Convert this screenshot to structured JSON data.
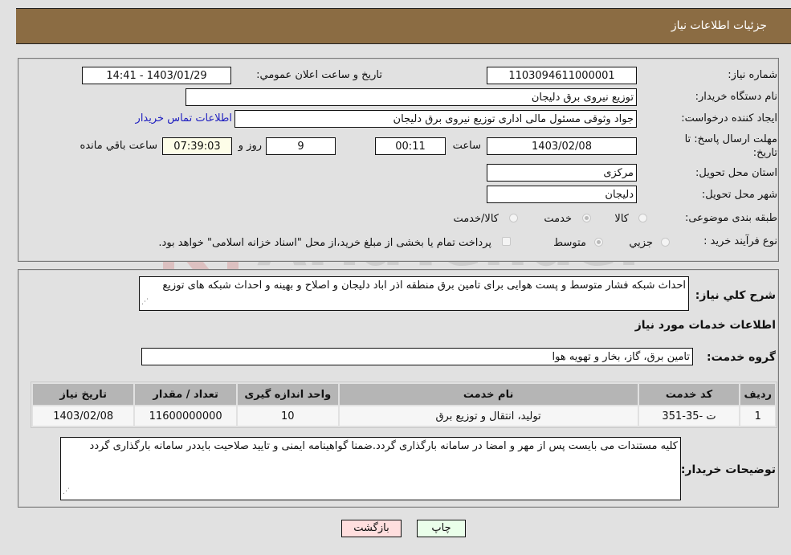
{
  "header": {
    "title": "جزئیات اطلاعات نیاز"
  },
  "details": {
    "need_number_label": "شماره نیاز:",
    "need_number": "1103094611000001",
    "announce_label": "تاریخ و ساعت اعلان عمومي:",
    "announce_value": "1403/01/29 - 14:41",
    "buyer_org_label": "نام دستگاه خریدار:",
    "buyer_org": "توزیع نیروی برق دلیجان",
    "creator_label": "ایجاد کننده درخواست:",
    "creator": "جواد وثوقی مسئول مالی اداری توزیع نیروی برق دلیجان",
    "buyer_contact_link": "اطلاعات تماس خریدار",
    "deadline_label": "مهلت ارسال پاسخ: تا تاریخ:",
    "deadline_date": "1403/02/08",
    "time_label": "ساعت",
    "deadline_time": "00:11",
    "days_value": "9",
    "days_label": "روز و",
    "remaining_time": "07:39:03",
    "remaining_label": "ساعت باقي مانده",
    "province_label": "استان محل تحویل:",
    "province": "مرکزی",
    "city_label": "شهر محل تحویل:",
    "city": "دلیجان",
    "category_label": "طبقه بندی موضوعی:",
    "category_options": [
      {
        "label": "کالا",
        "checked": false
      },
      {
        "label": "خدمت",
        "checked": true
      },
      {
        "label": "کالا/خدمت",
        "checked": false
      }
    ],
    "process_label": "نوع فرآیند خرید :",
    "process_options": [
      {
        "label": "جزیي",
        "checked": false
      },
      {
        "label": "متوسط",
        "checked": true
      }
    ],
    "treasury_note": "پرداخت تمام یا بخشی از مبلغ خرید،از محل \"اسناد خزانه اسلامی\" خواهد بود."
  },
  "description": {
    "label": "شرح کلي نیاز:",
    "text": "احداث شبکه فشار متوسط و پست هوایی برای تامین برق منطقه اذر اباد دلیجان و اصلاح و بهینه و احداث شبکه های توزیع"
  },
  "services": {
    "section_title": "اطلاعات خدمات مورد نیاز",
    "group_label": "گروه خدمت:",
    "group_value": "تامین برق، گاز، بخار و تهویه هوا",
    "table": {
      "headers": [
        "ردیف",
        "کد خدمت",
        "نام خدمت",
        "واحد اندازه گیری",
        "تعداد / مقدار",
        "تاریخ نیاز"
      ],
      "rows": [
        [
          "1",
          "ت -35-351",
          "تولید، انتقال و توزیع برق",
          "10",
          "11600000000",
          "1403/02/08"
        ]
      ]
    }
  },
  "buyer_notes": {
    "label": "توضیحات خریدار:",
    "text": "کلیه مستندات می بایست پس از مهر و امضا در سامانه بارگذاری گردد.ضمنا گواهینامه ایمنی و تایید صلاحیت بایددر سامانه بارگذاری گردد"
  },
  "buttons": {
    "print": "چاپ",
    "back": "بازگشت"
  },
  "colors": {
    "header_bg": "#8b6c43",
    "print_bg": "#eaffea",
    "back_bg": "#ffdede",
    "link": "#2020c0"
  }
}
